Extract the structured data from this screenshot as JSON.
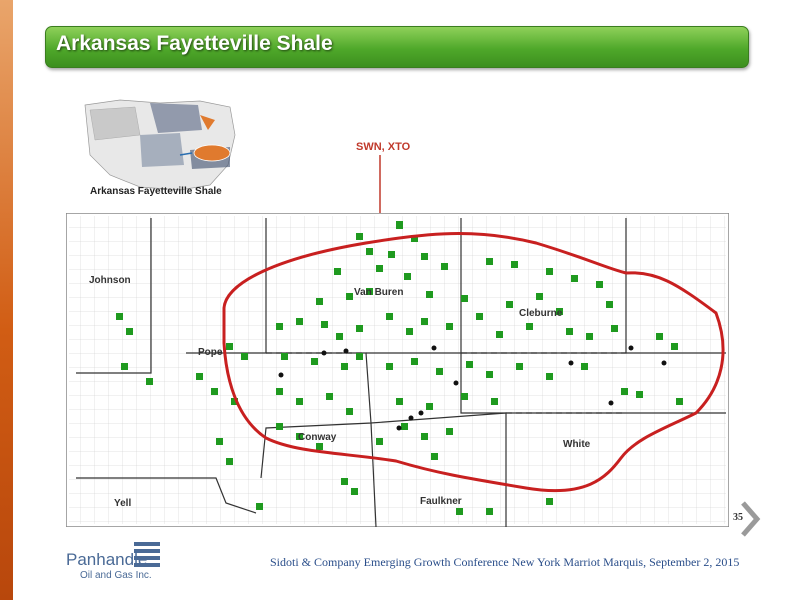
{
  "slide": {
    "title": "Arkansas Fayetteville Shale",
    "inset_label": "Arkansas Fayetteville Shale",
    "callout": "SWN, XTO",
    "page_number": "35",
    "footer": "Sidoti & Company Emerging Growth Conference New York Marriot Marquis, September 2, 2015",
    "logo": {
      "name": "Panhandle",
      "sub": "Oil and Gas Inc."
    },
    "counties": [
      "Johnson",
      "Van Buren",
      "Cleburne",
      "Pope",
      "Conway",
      "White",
      "Yell",
      "Faulkner"
    ],
    "colors": {
      "title_green": "#4fa82a",
      "play_outline": "#c82020",
      "leases": "#1f9a1f",
      "callout_red": "#c0392b"
    }
  }
}
